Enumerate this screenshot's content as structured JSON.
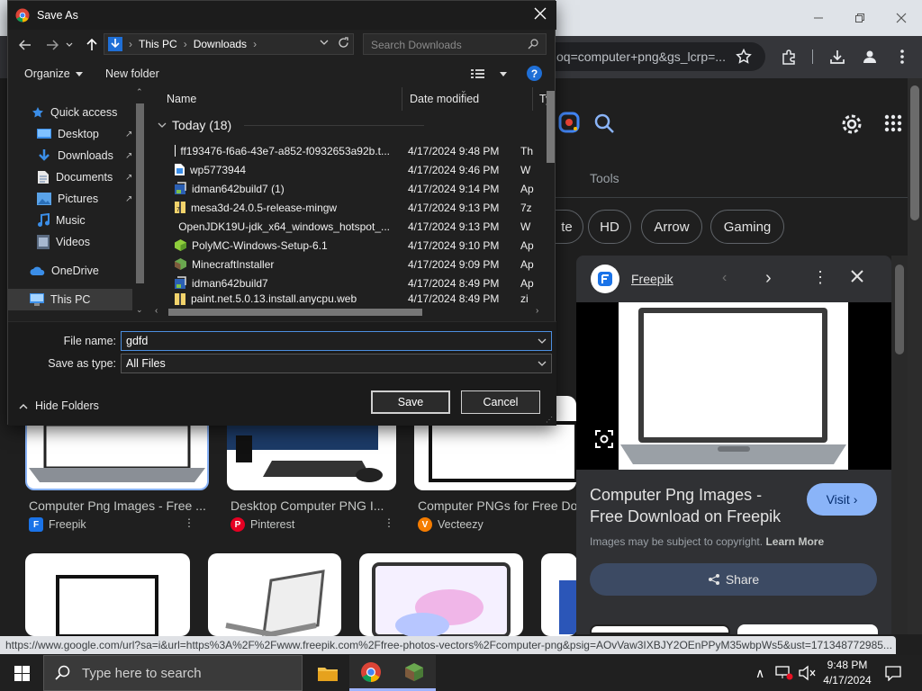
{
  "browser": {
    "omnibox_text": "oq=computer+png&gs_lcrp=...",
    "status_url": "https://www.google.com/url?sa=i&url=https%3A%2F%2Fwww.freepik.com%2Ffree-photos-vectors%2Fcomputer-png&psig=AOvVaw3IXBJY2OEnPPyM35wbpWs5&ust=171348772985..."
  },
  "google": {
    "tools_label": "Tools",
    "chips": [
      "te",
      "HD",
      "Arrow",
      "Gaming"
    ],
    "results": [
      {
        "caption": "Computer Png Images - Free ...",
        "source": "Freepik",
        "logo": "F",
        "color": "#1a73e8"
      },
      {
        "caption": "Desktop Computer PNG I...",
        "source": "Pinterest",
        "logo": "P",
        "color": "#e60023"
      },
      {
        "caption": "Computer PNGs for Free Do...",
        "source": "Vecteezy",
        "logo": "V",
        "color": "#f57c00"
      }
    ]
  },
  "side_panel": {
    "site": "Freepik",
    "title_line1": "Computer Png Images -",
    "title_line2": "Free Download on Freepik",
    "visit_label": "Visit",
    "copyright": "Images may be subject to copyright.",
    "learn_more": "Learn More",
    "share_label": "Share"
  },
  "dialog": {
    "title": "Save As",
    "breadcrumb": [
      "This PC",
      "Downloads"
    ],
    "search_placeholder": "Search Downloads",
    "organize_label": "Organize",
    "new_folder_label": "New folder",
    "nav_items": [
      {
        "label": "Quick access",
        "icon": "star-icon",
        "pinned": false
      },
      {
        "label": "Desktop",
        "icon": "desktop-icon",
        "pinned": true
      },
      {
        "label": "Downloads",
        "icon": "download-icon",
        "pinned": true
      },
      {
        "label": "Documents",
        "icon": "documents-icon",
        "pinned": true
      },
      {
        "label": "Pictures",
        "icon": "pictures-icon",
        "pinned": true
      },
      {
        "label": "Music",
        "icon": "music-icon",
        "pinned": false
      },
      {
        "label": "Videos",
        "icon": "videos-icon",
        "pinned": false
      },
      {
        "label": "OneDrive",
        "icon": "cloud-icon",
        "pinned": false
      },
      {
        "label": "This PC",
        "icon": "computer-icon",
        "pinned": false
      }
    ],
    "columns": {
      "name": "Name",
      "date": "Date modified",
      "type": "Ty"
    },
    "group_label": "Today (18)",
    "files": [
      {
        "name": "ff193476-f6a6-43e7-a852-f0932653a92b.t...",
        "date": "4/17/2024 9:48 PM",
        "type": "Th",
        "icon": "blank-file-icon"
      },
      {
        "name": "wp5773944",
        "date": "4/17/2024 9:46 PM",
        "type": "W",
        "icon": "image-file-icon"
      },
      {
        "name": "idman642build7 (1)",
        "date": "4/17/2024 9:14 PM",
        "type": "Ap",
        "icon": "installer-icon"
      },
      {
        "name": "mesa3d-24.0.5-release-mingw",
        "date": "4/17/2024 9:13 PM",
        "type": "7z",
        "icon": "archive-icon"
      },
      {
        "name": "OpenJDK19U-jdk_x64_windows_hotspot_...",
        "date": "4/17/2024 9:13 PM",
        "type": "W",
        "icon": "msi-icon"
      },
      {
        "name": "PolyMC-Windows-Setup-6.1",
        "date": "4/17/2024 9:10 PM",
        "type": "Ap",
        "icon": "polymc-icon"
      },
      {
        "name": "MinecraftInstaller",
        "date": "4/17/2024 9:09 PM",
        "type": "Ap",
        "icon": "minecraft-icon"
      },
      {
        "name": "idman642build7",
        "date": "4/17/2024 8:49 PM",
        "type": "Ap",
        "icon": "installer-icon"
      },
      {
        "name": "paint.net.5.0.13.install.anycpu.web",
        "date": "4/17/2024 8:49 PM",
        "type": "zi",
        "icon": "archive-icon"
      }
    ],
    "file_name_label": "File name:",
    "file_name_value": "gdfd",
    "save_type_label": "Save as type:",
    "save_type_value": "All Files",
    "hide_folders_label": "Hide Folders",
    "save_label": "Save",
    "cancel_label": "Cancel"
  },
  "taskbar": {
    "search_placeholder": "Type here to search",
    "time": "9:48 PM",
    "date": "4/17/2024"
  }
}
